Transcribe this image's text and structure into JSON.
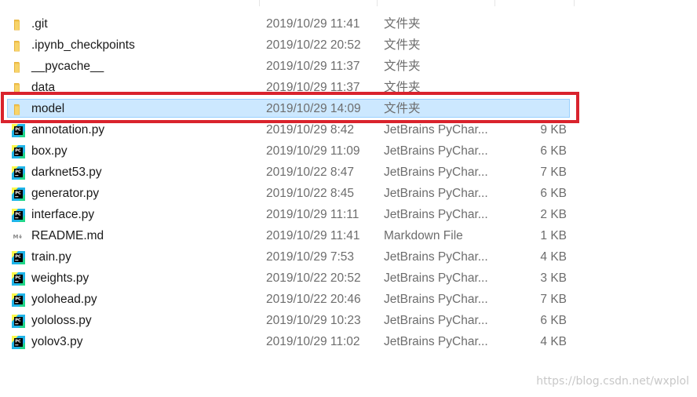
{
  "colors": {
    "selection_bg": "#cce8ff",
    "selection_border": "#99d1ff",
    "annotation_red": "#d9232d",
    "folder_yellow": "#f0c24d",
    "pycharm_green": "#21d789"
  },
  "files": [
    {
      "name": ".git",
      "date": "2019/10/29 11:41",
      "type": "文件夹",
      "size": "",
      "icon": "folder-icon",
      "selected": false
    },
    {
      "name": ".ipynb_checkpoints",
      "date": "2019/10/22 20:52",
      "type": "文件夹",
      "size": "",
      "icon": "folder-icon",
      "selected": false
    },
    {
      "name": "__pycache__",
      "date": "2019/10/29 11:37",
      "type": "文件夹",
      "size": "",
      "icon": "folder-icon",
      "selected": false
    },
    {
      "name": "data",
      "date": "2019/10/29 11:37",
      "type": "文件夹",
      "size": "",
      "icon": "folder-icon",
      "selected": false
    },
    {
      "name": "model",
      "date": "2019/10/29 14:09",
      "type": "文件夹",
      "size": "",
      "icon": "folder-icon",
      "selected": true
    },
    {
      "name": "annotation.py",
      "date": "2019/10/29 8:42",
      "type": "JetBrains PyChar...",
      "size": "9 KB",
      "icon": "pycharm-file-icon",
      "selected": false
    },
    {
      "name": "box.py",
      "date": "2019/10/29 11:09",
      "type": "JetBrains PyChar...",
      "size": "6 KB",
      "icon": "pycharm-file-icon",
      "selected": false
    },
    {
      "name": "darknet53.py",
      "date": "2019/10/22 8:47",
      "type": "JetBrains PyChar...",
      "size": "7 KB",
      "icon": "pycharm-file-icon",
      "selected": false
    },
    {
      "name": "generator.py",
      "date": "2019/10/22 8:45",
      "type": "JetBrains PyChar...",
      "size": "6 KB",
      "icon": "pycharm-file-icon",
      "selected": false
    },
    {
      "name": "interface.py",
      "date": "2019/10/29 11:11",
      "type": "JetBrains PyChar...",
      "size": "2 KB",
      "icon": "pycharm-file-icon",
      "selected": false
    },
    {
      "name": "README.md",
      "date": "2019/10/29 11:41",
      "type": "Markdown File",
      "size": "1 KB",
      "icon": "markdown-file-icon",
      "selected": false
    },
    {
      "name": "train.py",
      "date": "2019/10/29 7:53",
      "type": "JetBrains PyChar...",
      "size": "4 KB",
      "icon": "pycharm-file-icon",
      "selected": false
    },
    {
      "name": "weights.py",
      "date": "2019/10/22 20:52",
      "type": "JetBrains PyChar...",
      "size": "3 KB",
      "icon": "pycharm-file-icon",
      "selected": false
    },
    {
      "name": "yolohead.py",
      "date": "2019/10/22 20:46",
      "type": "JetBrains PyChar...",
      "size": "7 KB",
      "icon": "pycharm-file-icon",
      "selected": false
    },
    {
      "name": "yololoss.py",
      "date": "2019/10/29 10:23",
      "type": "JetBrains PyChar...",
      "size": "6 KB",
      "icon": "pycharm-file-icon",
      "selected": false
    },
    {
      "name": "yolov3.py",
      "date": "2019/10/29 11:02",
      "type": "JetBrains PyChar...",
      "size": "4 KB",
      "icon": "pycharm-file-icon",
      "selected": false
    }
  ],
  "watermark": "https://blog.csdn.net/wxplol"
}
